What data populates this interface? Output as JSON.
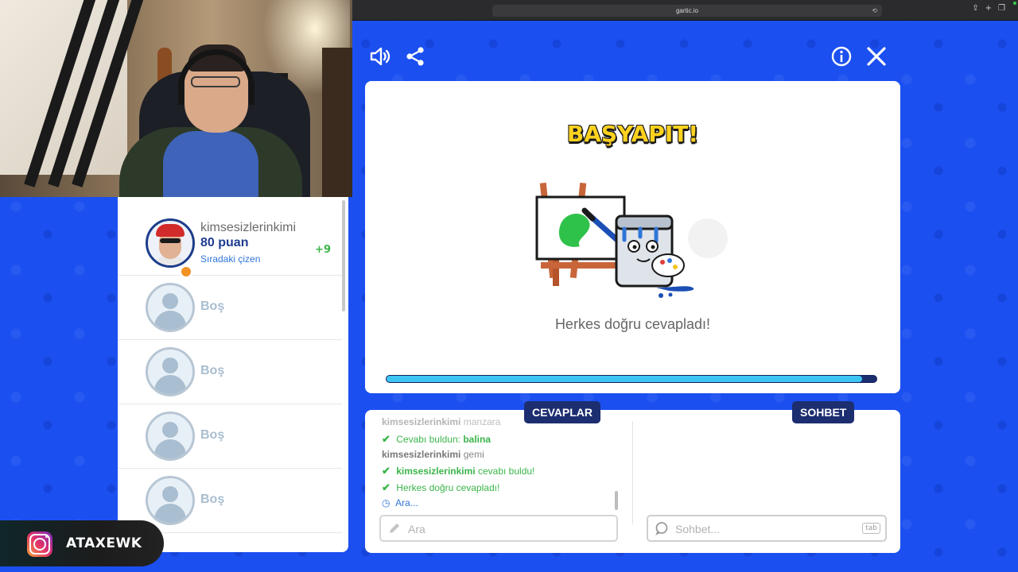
{
  "browser": {
    "url": "gartic.io"
  },
  "players": [
    {
      "name": "kimsesizlerinkimi",
      "points": "80 puan",
      "next_drawer": "Sıradaki çizen",
      "gain": "+9"
    },
    {
      "empty_label": "Boş"
    },
    {
      "empty_label": "Boş"
    },
    {
      "empty_label": "Boş"
    },
    {
      "empty_label": "Boş"
    }
  ],
  "result": {
    "title": "BAŞYAPIT!",
    "message": "Herkes doğru cevapladı!",
    "timer_progress": 0.97
  },
  "tabs": {
    "answers": "CEVAPLAR",
    "chat": "SOHBET"
  },
  "answers_feed": {
    "line0": {
      "user": "kimsesizlerinkimi",
      "text": "manzara"
    },
    "line1": {
      "prefix": "Cevabı buldun:",
      "answer": "balina"
    },
    "line2": {
      "user": "kimsesizlerinkimi",
      "text": "gemi"
    },
    "line3": {
      "user": "kimsesizlerinkimi",
      "text": "cevabı buldu!"
    },
    "line4": {
      "text": "Herkes doğru cevapladı!"
    },
    "line5": {
      "text": "Ara..."
    }
  },
  "inputs": {
    "answer_placeholder": "Ara",
    "chat_placeholder": "Sohbet...",
    "chat_hint": "tab"
  },
  "overlay": {
    "instagram_handle": "ATAXEWK"
  },
  "colors": {
    "background": "#1b4ff0",
    "tab_navy": "#1c2e70",
    "progress": "#3cc5f2",
    "success_green": "#3bb54a",
    "title_yellow": "#ffd21f"
  }
}
